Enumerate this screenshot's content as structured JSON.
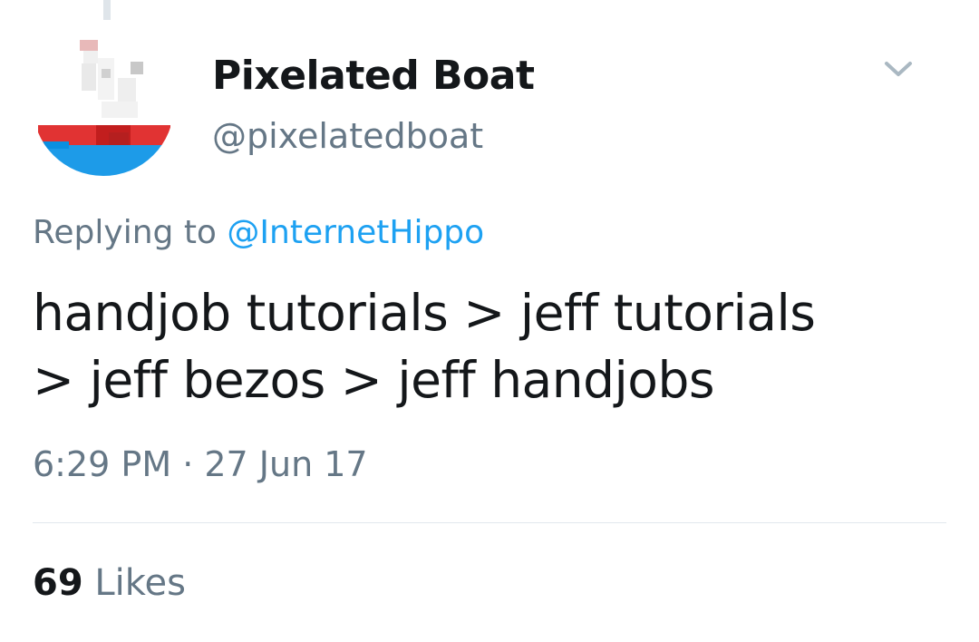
{
  "tweet": {
    "author": {
      "display_name": "Pixelated Boat",
      "handle": "@pixelatedboat",
      "avatar_icon": "pixel-boat-avatar"
    },
    "menu_icon": "chevron-down-icon",
    "reply": {
      "prefix": "Replying to",
      "mention": "@InternetHippo"
    },
    "text_lines": [
      "handjob tutorials > jeff tutorials",
      "> jeff bezos > jeff handjobs"
    ],
    "timestamp": "6:29 PM · 27 Jun 17",
    "likes": {
      "count": "69",
      "label": "Likes"
    }
  },
  "colors": {
    "primary_text": "#14171a",
    "secondary_text": "#657786",
    "link": "#1da1f2",
    "divider": "#e1e8ed",
    "thread_line": "#dfe5ea"
  }
}
